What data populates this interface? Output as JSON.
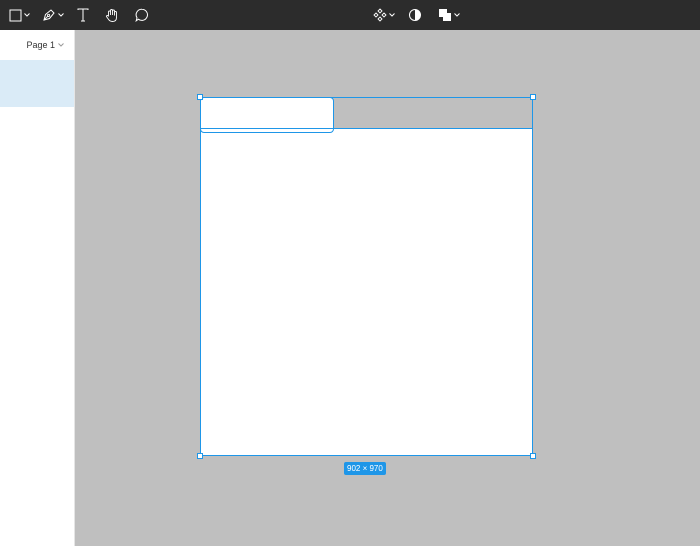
{
  "toolbar": {
    "tools": [
      {
        "icon": "frame-icon"
      },
      {
        "icon": "pen-icon"
      },
      {
        "icon": "text-icon"
      },
      {
        "icon": "hand-icon"
      },
      {
        "icon": "comment-icon"
      }
    ],
    "center_tools": [
      {
        "icon": "component-icon"
      },
      {
        "icon": "mask-icon"
      },
      {
        "icon": "boolean-icon"
      }
    ]
  },
  "sidebar": {
    "page_label": "Page 1"
  },
  "canvas": {
    "selection_dimensions": "902 × 970"
  },
  "colors": {
    "toolbar_bg": "#2c2c2c",
    "canvas_bg": "#bfbfbf",
    "selection": "#1e96e8",
    "layer_highlight": "#daebf7"
  }
}
